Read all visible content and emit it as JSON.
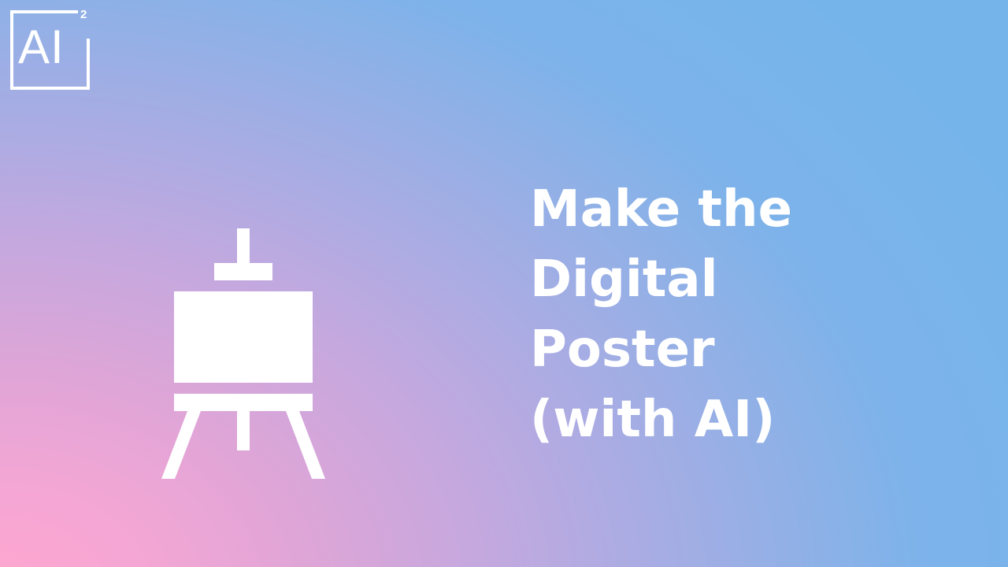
{
  "logo": {
    "text": "AI",
    "superscript": "2"
  },
  "easel_icon": "easel-icon",
  "headline": {
    "lines": [
      "Make the",
      "Digital",
      "Poster",
      "(with AI)"
    ]
  },
  "colors": {
    "gradient_pink": "#ffa7cf",
    "gradient_purple": "#c6a8de",
    "gradient_blue": "#74b4ea",
    "foreground": "#ffffff"
  }
}
